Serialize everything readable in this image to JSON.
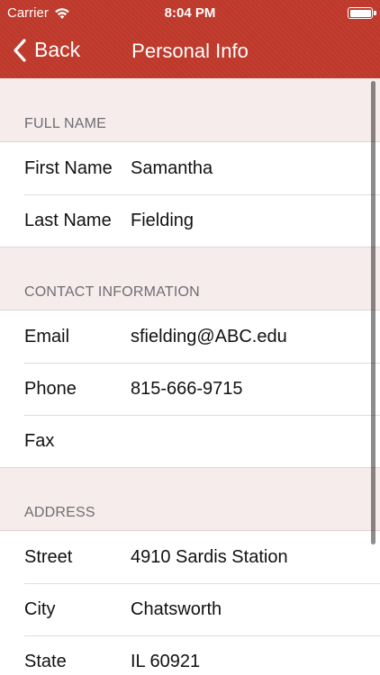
{
  "status_bar": {
    "carrier": "Carrier",
    "time": "8:04 PM"
  },
  "nav": {
    "back_label": "Back",
    "title": "Personal Info"
  },
  "colors": {
    "accent": "#c0392b",
    "section_bg": "#f7ecec"
  },
  "sections": [
    {
      "header": "FULL NAME",
      "rows": [
        {
          "label": "First Name",
          "value": "Samantha"
        },
        {
          "label": "Last Name",
          "value": "Fielding"
        }
      ]
    },
    {
      "header": "CONTACT INFORMATION",
      "rows": [
        {
          "label": "Email",
          "value": "sfielding@ABC.edu"
        },
        {
          "label": "Phone",
          "value": "815-666-9715"
        },
        {
          "label": "Fax",
          "value": ""
        }
      ]
    },
    {
      "header": "ADDRESS",
      "rows": [
        {
          "label": "Street",
          "value": "4910 Sardis Station"
        },
        {
          "label": "City",
          "value": "Chatsworth"
        },
        {
          "label": "State",
          "value": "IL 60921"
        }
      ]
    }
  ]
}
